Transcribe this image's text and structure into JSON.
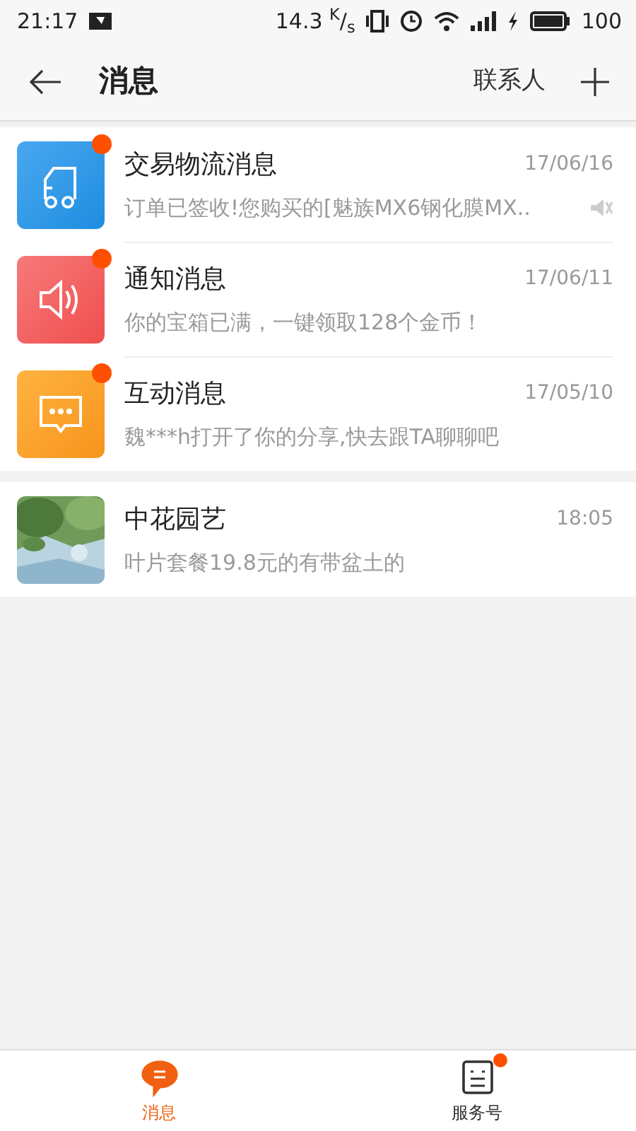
{
  "status_bar": {
    "time": "21:17",
    "speed": "14.3 $^{K}$/$_{s}$",
    "battery": "100"
  },
  "header": {
    "title": "消息",
    "contacts": "联系人"
  },
  "groups": [
    {
      "items": [
        {
          "kind": "truck",
          "title": "交易物流消息",
          "time": "17/06/16",
          "preview": "订单已签收!您购买的[魅族MX6钢化膜MX..",
          "unread": true,
          "muted": true
        },
        {
          "kind": "speaker",
          "title": "通知消息",
          "time": "17/06/11",
          "preview": "你的宝箱已满，一键领取128个金币！",
          "unread": true,
          "muted": false
        },
        {
          "kind": "chat",
          "title": "互动消息",
          "time": "17/05/10",
          "preview": "魏***h打开了你的分享,快去跟TA聊聊吧",
          "unread": true,
          "muted": false
        }
      ]
    },
    {
      "items": [
        {
          "kind": "picture",
          "title": "中花园艺",
          "time": "18:05",
          "preview": "叶片套餐19.8元的有带盆土的",
          "unread": false,
          "muted": false
        }
      ]
    }
  ],
  "tabs": [
    {
      "kind": "chat",
      "label": "消息",
      "selected": true,
      "badge": false
    },
    {
      "kind": "service",
      "label": "服务号",
      "selected": false,
      "badge": true
    }
  ]
}
